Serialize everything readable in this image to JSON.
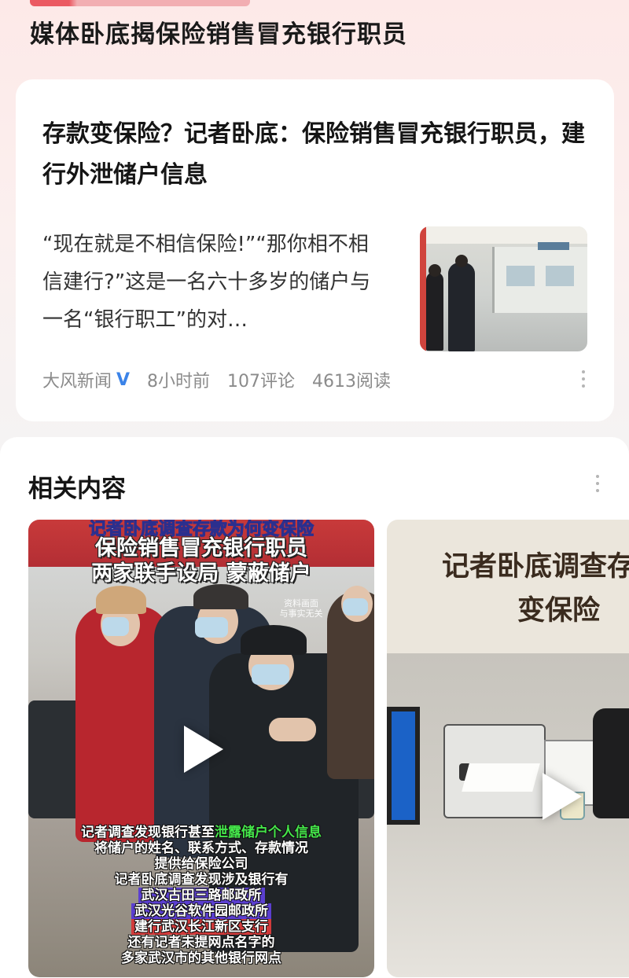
{
  "hot_title": "媒体卧底揭保险销售冒充银行职员",
  "article": {
    "headline": "存款变保险？记者卧底：保险销售冒充银行职员，建行外泄储户信息",
    "summary": "“现在就是不相信保险!”“那你相不相信建行?”这是一名六十多岁的储户与一名“银行职工”的对…",
    "source": "大风新闻",
    "verified_mark": "V",
    "time": "8小时前",
    "comments": "107评论",
    "reads": "4613阅读",
    "thumbnail_icon": "photo-bank-hall"
  },
  "related": {
    "title": "相关内容",
    "videos": [
      {
        "top_caption": "记者卧底调查存款为何变保险",
        "line1": "保险销售冒充银行职员",
        "line2": "两家联手设局 蒙蔽储户",
        "disclaimer_1": "资料画面",
        "disclaimer_2": "与事实无关",
        "subtitles": [
          {
            "text": "记者调查发现银行甚至",
            "em": "泄露储户个人信息"
          },
          {
            "text": "将储户的姓名、联系方式、存款情况"
          },
          {
            "text": "提供给保险公司"
          },
          {
            "text": "记者卧底调查发现涉及银行有"
          },
          {
            "text": "武汉古田三路邮政所",
            "style": "hl"
          },
          {
            "text": "武汉光谷软件园邮政所",
            "style": "hl"
          },
          {
            "text": "建行武汉长江新区支行",
            "style": "hl2"
          },
          {
            "text": "还有记者未提网点名字的"
          },
          {
            "text": "多家武汉市的其他银行网点"
          }
        ],
        "play_icon": "play-icon"
      },
      {
        "title_line1": "记者卧底调查存",
        "title_line2": "变保险",
        "play_icon": "play-icon"
      }
    ]
  },
  "colors": {
    "verified": "#3b83e8",
    "subtitle_highlight": "#44e64a",
    "banner_red": "#c83a3a"
  }
}
